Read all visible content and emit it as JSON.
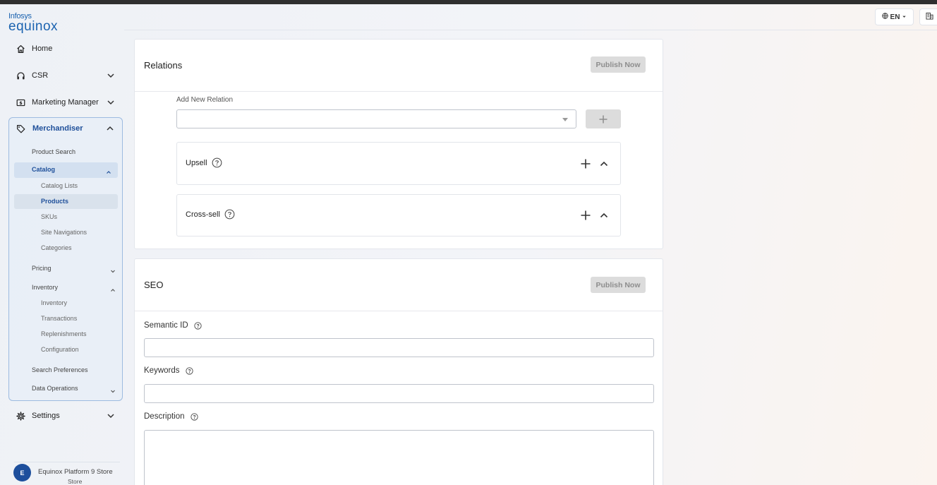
{
  "logo": {
    "line1": "Infosys",
    "line2": "equinox"
  },
  "header": {
    "language": "EN"
  },
  "sidebar": {
    "home": "Home",
    "csr": "CSR",
    "marketing": "Marketing Manager",
    "merchandiser": {
      "label": "Merchandiser",
      "product_search": "Product Search",
      "catalog": "Catalog",
      "catalog_items": [
        "Catalog Lists",
        "Products",
        "SKUs",
        "Site Navigations",
        "Categories"
      ],
      "pricing": "Pricing",
      "inventory": "Inventory",
      "inventory_items": [
        "Inventory",
        "Transactions",
        "Replenishments",
        "Configuration"
      ],
      "search_preferences": "Search Preferences",
      "data_operations": "Data Operations"
    },
    "settings": "Settings",
    "user": {
      "initial": "E",
      "store_name": "Equinox Platform 9 Store",
      "store_sub": "Store"
    }
  },
  "relations": {
    "title": "Relations",
    "publish_label": "Publish Now",
    "add_new_label": "Add New Relation",
    "select_value": "",
    "panels": [
      "Upsell",
      "Cross-sell"
    ]
  },
  "seo": {
    "title": "SEO",
    "publish_label": "Publish Now",
    "fields": {
      "semantic_id": {
        "label": "Semantic ID",
        "value": ""
      },
      "keywords": {
        "label": "Keywords",
        "value": ""
      },
      "description": {
        "label": "Description",
        "value": ""
      }
    }
  },
  "colors": {
    "accent": "#1e4f9a",
    "disabled_button": "#dcdcdc",
    "disabled_text": "#8d8d8d"
  }
}
